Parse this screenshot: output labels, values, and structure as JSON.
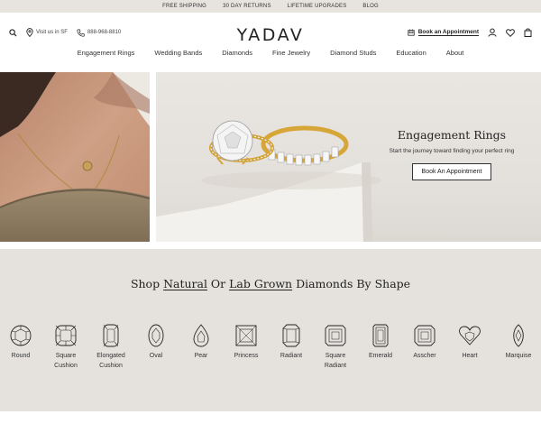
{
  "topbar": {
    "items": [
      "FREE SHIPPING",
      "30 DAY RETURNS",
      "LIFETIME UPGRADES",
      "BLOG"
    ]
  },
  "header": {
    "logo": "YADAV",
    "visit": "Visit us in SF",
    "phone": "888-968-8810",
    "appointment": "Book an Appointment",
    "icons": [
      "search-icon",
      "location-pin-icon",
      "phone-icon",
      "calendar-icon",
      "user-icon",
      "heart-icon",
      "shopping-bag-icon"
    ]
  },
  "nav": [
    "Engagement Rings",
    "Wedding Bands",
    "Diamonds",
    "Fine Jewelry",
    "Diamond Studs",
    "Education",
    "About"
  ],
  "hero": {
    "title": "Engagement Rings",
    "subtitle": "Start the journey toward finding your perfect ring",
    "button": "Book An Appointment"
  },
  "shapes_section": {
    "title_pre": "Shop ",
    "title_link1": "Natural",
    "title_mid": " Or ",
    "title_link2": "Lab Grown",
    "title_post": " Diamonds By Shape",
    "shapes": [
      {
        "name": "Round",
        "lines": [
          "Round"
        ]
      },
      {
        "name": "Square Cushion",
        "lines": [
          "Square",
          "Cushion"
        ]
      },
      {
        "name": "Elongated Cushion",
        "lines": [
          "Elongated",
          "Cushion"
        ]
      },
      {
        "name": "Oval",
        "lines": [
          "Oval"
        ]
      },
      {
        "name": "Pear",
        "lines": [
          "Pear"
        ]
      },
      {
        "name": "Princess",
        "lines": [
          "Princess"
        ]
      },
      {
        "name": "Radiant",
        "lines": [
          "Radiant"
        ]
      },
      {
        "name": "Square Radiant",
        "lines": [
          "Square",
          "Radiant"
        ]
      },
      {
        "name": "Emerald",
        "lines": [
          "Emerald"
        ]
      },
      {
        "name": "Asscher",
        "lines": [
          "Asscher"
        ]
      },
      {
        "name": "Heart",
        "lines": [
          "Heart"
        ]
      },
      {
        "name": "Marquise",
        "lines": [
          "Marquise"
        ]
      }
    ]
  }
}
